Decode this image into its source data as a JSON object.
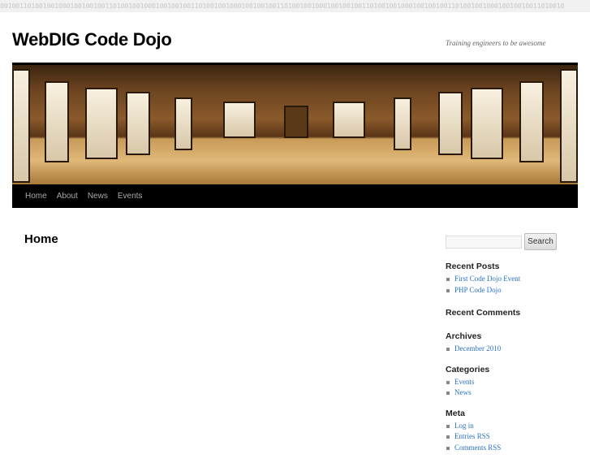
{
  "binary_strip": "0010011010010010001001001001101001001000100100100110100100100010010010011010010010001001001001101001001000100100100110100100100010010010011010010",
  "site": {
    "title": "WebDIG Code Dojo",
    "tagline": "Training engineers to be awesome"
  },
  "nav": [
    {
      "label": "Home"
    },
    {
      "label": "About"
    },
    {
      "label": "News"
    },
    {
      "label": "Events"
    }
  ],
  "main": {
    "page_title": "Home"
  },
  "search": {
    "placeholder": "",
    "button_label": "Search"
  },
  "sidebar": {
    "recent_posts": {
      "title": "Recent Posts",
      "items": [
        "First Code Dojo Event",
        "PHP Code Dojo"
      ]
    },
    "recent_comments": {
      "title": "Recent Comments"
    },
    "archives": {
      "title": "Archives",
      "items": [
        "December 2010"
      ]
    },
    "categories": {
      "title": "Categories",
      "items": [
        "Events",
        "News"
      ]
    },
    "meta": {
      "title": "Meta",
      "items": [
        "Log in",
        "Entries RSS",
        "Comments RSS"
      ]
    }
  },
  "colors": {
    "link": "#2a73c4",
    "nav_bg": "#000000"
  }
}
